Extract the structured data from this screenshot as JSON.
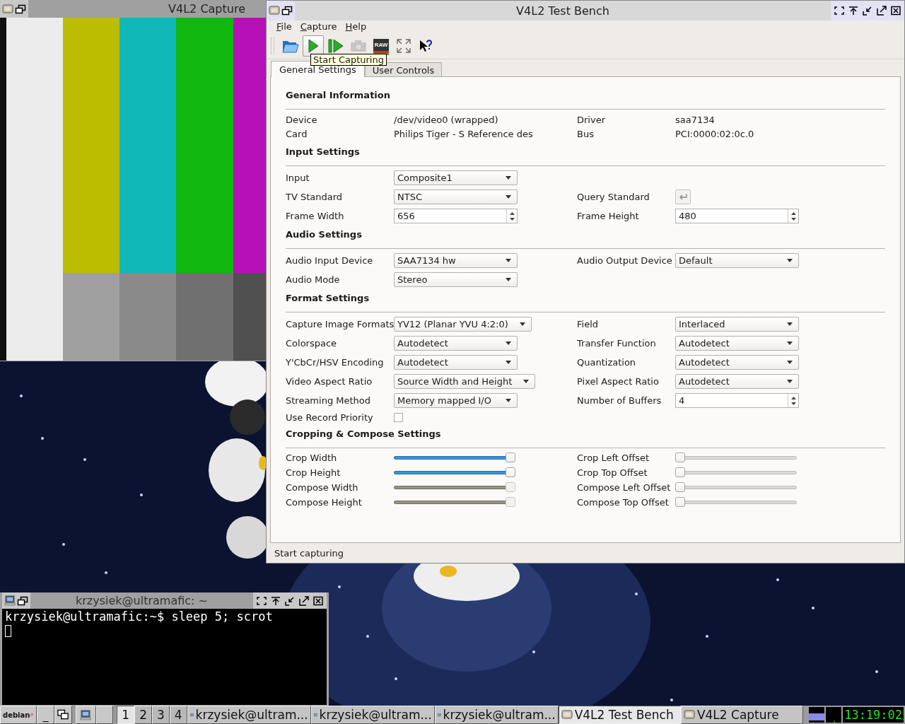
{
  "capture_window": {
    "title": "V4L2 Capture"
  },
  "main_window": {
    "title": "V4L2 Test Bench",
    "menu": [
      "File",
      "Capture",
      "Help"
    ],
    "toolbar": [
      {
        "kind": "open",
        "hovered": false,
        "disabled": false
      },
      {
        "kind": "play",
        "hovered": true,
        "disabled": false
      },
      {
        "kind": "step",
        "hovered": false,
        "disabled": false
      },
      {
        "kind": "camera",
        "hovered": false,
        "disabled": true
      },
      {
        "kind": "raw",
        "label": "RAW",
        "hovered": false,
        "disabled": false
      },
      {
        "kind": "fullscreen",
        "hovered": false,
        "disabled": false
      },
      {
        "kind": "whatsthis",
        "hovered": false,
        "disabled": false
      }
    ],
    "tooltip": "Start Capturing",
    "tabs": [
      {
        "label": "General Settings",
        "selected": true
      },
      {
        "label": "User Controls",
        "selected": false
      }
    ],
    "sections": [
      {
        "title": "General Information",
        "kind": "info",
        "rows": [
          [
            {
              "label": "Device",
              "control": {
                "kind": "text",
                "value": "/dev/video0 (wrapped)"
              }
            },
            {
              "label": "Driver",
              "control": {
                "kind": "text",
                "value": "saa7134"
              }
            }
          ],
          [
            {
              "label": "Card",
              "control": {
                "kind": "text",
                "value": "Philips Tiger - S Reference des"
              }
            },
            {
              "label": "Bus",
              "control": {
                "kind": "text",
                "value": "PCI:0000:02:0c.0"
              }
            }
          ]
        ]
      },
      {
        "title": "Input Settings",
        "kind": "form",
        "rows": [
          [
            {
              "label": "Input",
              "control": {
                "kind": "combo",
                "value": "Composite1"
              }
            }
          ],
          [
            {
              "label": "TV Standard",
              "control": {
                "kind": "combo",
                "value": "NTSC"
              }
            },
            {
              "label": "Query Standard",
              "control": {
                "kind": "button"
              }
            }
          ],
          [
            {
              "label": "Frame Width",
              "control": {
                "kind": "spin",
                "value": "656"
              }
            },
            {
              "label": "Frame Height",
              "control": {
                "kind": "spin",
                "value": "480"
              }
            }
          ]
        ]
      },
      {
        "title": "Audio Settings",
        "kind": "form",
        "rows": [
          [
            {
              "label": "Audio Input Device",
              "control": {
                "kind": "combo",
                "value": "SAA7134 hw"
              }
            },
            {
              "label": "Audio Output Device",
              "control": {
                "kind": "combo",
                "value": "Default"
              }
            }
          ],
          [
            {
              "label": "Audio Mode",
              "control": {
                "kind": "combo",
                "value": "Stereo"
              }
            }
          ]
        ]
      },
      {
        "title": "Format Settings",
        "kind": "form",
        "rows": [
          [
            {
              "label": "Capture Image Formats",
              "control": {
                "kind": "combo",
                "value": "YV12 (Planar YVU 4:2:0)"
              }
            },
            {
              "label": "Field",
              "control": {
                "kind": "combo",
                "value": "Interlaced"
              }
            }
          ],
          [
            {
              "label": "Colorspace",
              "control": {
                "kind": "combo",
                "value": "Autodetect"
              }
            },
            {
              "label": "Transfer Function",
              "control": {
                "kind": "combo",
                "value": "Autodetect"
              }
            }
          ],
          [
            {
              "label": "Y'CbCr/HSV Encoding",
              "control": {
                "kind": "combo",
                "value": "Autodetect"
              }
            },
            {
              "label": "Quantization",
              "control": {
                "kind": "combo",
                "value": "Autodetect"
              }
            }
          ],
          [
            {
              "label": "Video Aspect Ratio",
              "control": {
                "kind": "combo",
                "value": "Source Width and Height"
              }
            },
            {
              "label": "Pixel Aspect Ratio",
              "control": {
                "kind": "combo",
                "value": "Autodetect"
              }
            }
          ],
          [
            {
              "label": "Streaming Method",
              "control": {
                "kind": "combo",
                "value": "Memory mapped I/O"
              }
            },
            {
              "label": "Number of Buffers",
              "control": {
                "kind": "spin",
                "value": "4"
              }
            }
          ],
          [
            {
              "label": "Use Record Priority",
              "control": {
                "kind": "checkbox",
                "checked": false
              }
            }
          ]
        ]
      },
      {
        "title": "Cropping & Compose Settings",
        "kind": "sliders",
        "rows": [
          [
            {
              "label": "Crop Width",
              "control": {
                "kind": "slider",
                "level": 1,
                "disabled": false
              }
            },
            {
              "label": "Crop Left Offset",
              "control": {
                "kind": "slider",
                "level": 0,
                "disabled": false
              }
            }
          ],
          [
            {
              "label": "Crop Height",
              "control": {
                "kind": "slider",
                "level": 1,
                "disabled": false
              }
            },
            {
              "label": "Crop Top Offset",
              "control": {
                "kind": "slider",
                "level": 0,
                "disabled": false
              }
            }
          ],
          [
            {
              "label": "Compose Width",
              "control": {
                "kind": "slider",
                "level": 1,
                "disabled": true
              }
            },
            {
              "label": "Compose Left Offset",
              "control": {
                "kind": "slider",
                "level": 0,
                "disabled": false
              }
            }
          ],
          [
            {
              "label": "Compose Height",
              "control": {
                "kind": "slider",
                "level": 1,
                "disabled": true
              }
            },
            {
              "label": "Compose Top Offset",
              "control": {
                "kind": "slider",
                "level": 0,
                "disabled": false
              }
            }
          ]
        ]
      }
    ],
    "status_bar": "Start capturing"
  },
  "terminal_window": {
    "title": "krzysiek@ultramafic: ~",
    "lines": [
      "krzysiek@ultramafic:~$ sleep 5; scrot"
    ]
  },
  "taskbar": {
    "logo_text": "debian",
    "minimize_label": "_",
    "desktops": [
      {
        "label": "1",
        "selected": true
      },
      {
        "label": "2",
        "selected": false
      },
      {
        "label": "3",
        "selected": false
      },
      {
        "label": "4",
        "selected": false
      }
    ],
    "tasks": [
      {
        "kind": "terminal",
        "label": "krzysiek@ultram...",
        "selected": false
      },
      {
        "kind": "terminal",
        "label": "krzysiek@ultram...",
        "selected": false
      },
      {
        "kind": "terminal",
        "label": "krzysiek@ultram...",
        "selected": false
      },
      {
        "kind": "window",
        "label": "V4L2 Test Bench",
        "selected": true
      },
      {
        "kind": "window",
        "label": "V4L2 Capture",
        "selected": false
      }
    ],
    "clock": "13:19:02"
  }
}
